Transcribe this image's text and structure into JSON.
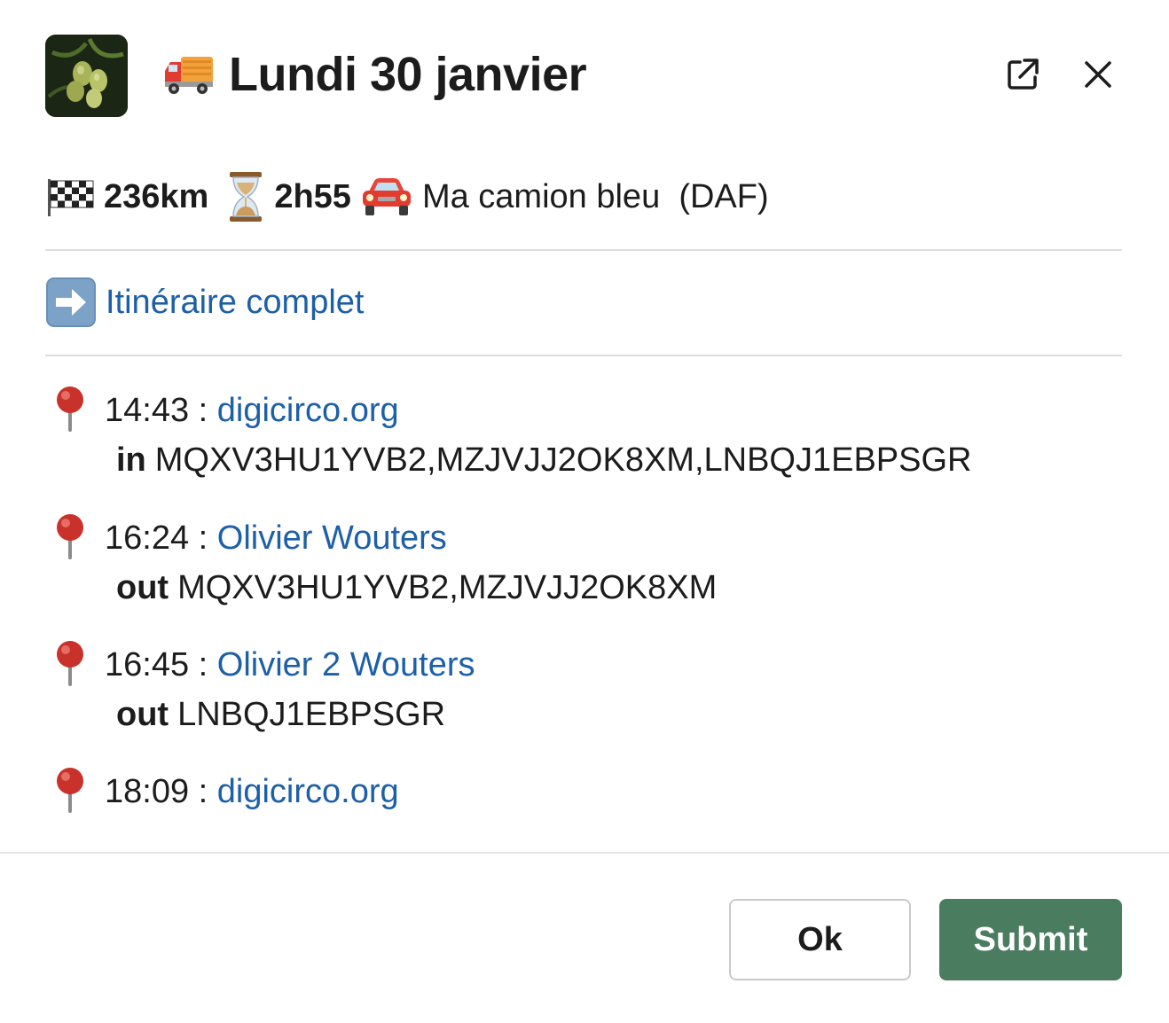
{
  "header": {
    "title": "Lundi 30 janvier",
    "title_emoji": "delivery-truck-icon",
    "app_avatar": "olive-branch-avatar",
    "open_icon": "open-in-new-window-icon",
    "close_icon": "close-icon"
  },
  "stats": {
    "distance_icon": "checkered-flag-icon",
    "distance": "236km",
    "duration_icon": "hourglass-icon",
    "duration": "2h55",
    "vehicle_icon": "red-car-icon",
    "vehicle": "Ma camion bleu  (DAF)"
  },
  "itinerary_link": {
    "icon": "right-arrow-icon",
    "label": "Itinéraire complet"
  },
  "stops": [
    {
      "time": "14:43",
      "separator": " : ",
      "place": "digicirco.org",
      "action": "in",
      "codes": "MQXV3HU1YVB2,MZJVJJ2OK8XM,LNBQJ1EBPSGR"
    },
    {
      "time": "16:24",
      "separator": " : ",
      "place": "Olivier Wouters",
      "action": "out",
      "codes": "MQXV3HU1YVB2,MZJVJJ2OK8XM"
    },
    {
      "time": "16:45",
      "separator": " : ",
      "place": "Olivier 2 Wouters",
      "action": "out",
      "codes": "LNBQJ1EBPSGR"
    },
    {
      "time": "18:09",
      "separator": " : ",
      "place": "digicirco.org"
    }
  ],
  "footer": {
    "ok_label": "Ok",
    "submit_label": "Submit"
  },
  "colors": {
    "link": "#1d5fa8",
    "submit_bg": "#4a7c60",
    "text": "#1d1c1d"
  }
}
